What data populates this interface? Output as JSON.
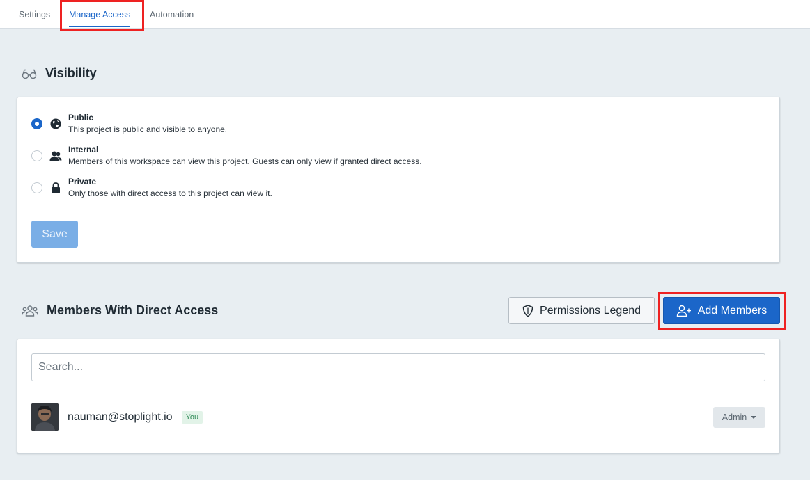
{
  "tabs": [
    {
      "label": "Settings"
    },
    {
      "label": "Manage Access",
      "active": true
    },
    {
      "label": "Automation"
    }
  ],
  "visibility": {
    "title": "Visibility",
    "icon": "glasses-icon",
    "options": [
      {
        "title": "Public",
        "description": "This project is public and visible to anyone.",
        "icon": "globe-icon",
        "checked": true
      },
      {
        "title": "Internal",
        "description": "Members of this workspace can view this project. Guests can only view if granted direct access.",
        "icon": "users-icon",
        "checked": false
      },
      {
        "title": "Private",
        "description": "Only those with direct access to this project can view it.",
        "icon": "lock-icon",
        "checked": false
      }
    ],
    "save_label": "Save"
  },
  "members": {
    "title": "Members With Direct Access",
    "icon": "people-group-icon",
    "permissions_legend_label": "Permissions Legend",
    "add_members_label": "Add Members",
    "search_placeholder": "Search...",
    "list": [
      {
        "email": "nauman@stoplight.io",
        "badge": "You",
        "role": "Admin"
      }
    ]
  },
  "colors": {
    "accent": "#1b66c9",
    "highlight": "#ee2222",
    "background": "#e8eef2"
  }
}
